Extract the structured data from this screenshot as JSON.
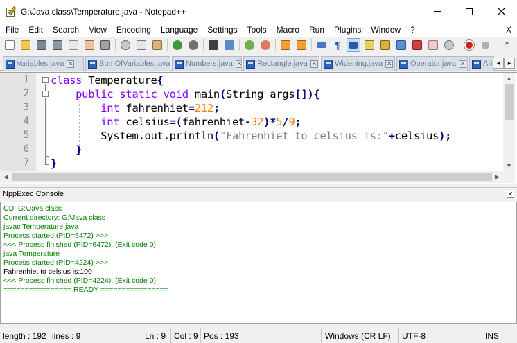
{
  "window": {
    "title": "G:\\Java class\\Temperature.java - Notepad++"
  },
  "menu": {
    "items": [
      "File",
      "Edit",
      "Search",
      "View",
      "Encoding",
      "Language",
      "Settings",
      "Tools",
      "Macro",
      "Run",
      "Plugins",
      "Window",
      "?"
    ],
    "close_label": "X"
  },
  "toolbar": {
    "buttons": [
      "new-file",
      "open-file",
      "save",
      "save-all",
      "close",
      "close-all",
      "print",
      "cut",
      "copy",
      "paste",
      "undo",
      "redo",
      "find",
      "replace",
      "zoom-in",
      "zoom-out",
      "sync-vertical",
      "sync-horizontal",
      "word-wrap",
      "show-all-chars",
      "indent-guide",
      "udl",
      "doc-map",
      "function-list",
      "folder-as-workspace",
      "monitoring",
      "record-macro",
      "stop-record"
    ]
  },
  "tabs": [
    {
      "label": "Variables.java"
    },
    {
      "label": "SumOfVariables.java"
    },
    {
      "label": "Numbers.java"
    },
    {
      "label": "Rectangle.java"
    },
    {
      "label": "Widening.java"
    },
    {
      "label": "Operator.java"
    },
    {
      "label": "Arit"
    }
  ],
  "editor": {
    "line_numbers": [
      "1",
      "2",
      "3",
      "4",
      "5",
      "6",
      "7"
    ],
    "lines": [
      [
        {
          "t": "class",
          "c": "kw"
        },
        {
          "t": " Temperature",
          "c": "plain"
        },
        {
          "t": "{",
          "c": "op"
        }
      ],
      [
        {
          "t": "    ",
          "c": "plain"
        },
        {
          "t": "public",
          "c": "kw"
        },
        {
          "t": " ",
          "c": "plain"
        },
        {
          "t": "static",
          "c": "kw"
        },
        {
          "t": " ",
          "c": "plain"
        },
        {
          "t": "void",
          "c": "kwt"
        },
        {
          "t": " main",
          "c": "plain"
        },
        {
          "t": "(",
          "c": "op"
        },
        {
          "t": "String args",
          "c": "plain"
        },
        {
          "t": "[]){",
          "c": "op"
        }
      ],
      [
        {
          "t": "        ",
          "c": "plain"
        },
        {
          "t": "int",
          "c": "kwt"
        },
        {
          "t": " fahrenhiet",
          "c": "plain"
        },
        {
          "t": "=",
          "c": "op"
        },
        {
          "t": "212",
          "c": "num"
        },
        {
          "t": ";",
          "c": "op"
        }
      ],
      [
        {
          "t": "        ",
          "c": "plain"
        },
        {
          "t": "int",
          "c": "kwt"
        },
        {
          "t": " celsius",
          "c": "plain"
        },
        {
          "t": "=(",
          "c": "op"
        },
        {
          "t": "fahrenhiet",
          "c": "plain"
        },
        {
          "t": "-",
          "c": "op"
        },
        {
          "t": "32",
          "c": "num"
        },
        {
          "t": ")*",
          "c": "op"
        },
        {
          "t": "5",
          "c": "num"
        },
        {
          "t": "/",
          "c": "op"
        },
        {
          "t": "9",
          "c": "num"
        },
        {
          "t": ";",
          "c": "op"
        }
      ],
      [
        {
          "t": "        System",
          "c": "plain"
        },
        {
          "t": ".",
          "c": "op"
        },
        {
          "t": "out",
          "c": "plain"
        },
        {
          "t": ".",
          "c": "op"
        },
        {
          "t": "println",
          "c": "plain"
        },
        {
          "t": "(",
          "c": "op"
        },
        {
          "t": "\"Fahrenhiet to celsius is:\"",
          "c": "str"
        },
        {
          "t": "+",
          "c": "op"
        },
        {
          "t": "celsius",
          "c": "plain"
        },
        {
          "t": ");",
          "c": "op"
        }
      ],
      [
        {
          "t": "    ",
          "c": "plain"
        },
        {
          "t": "}",
          "c": "op"
        }
      ],
      [
        {
          "t": "}",
          "c": "op"
        }
      ]
    ]
  },
  "console": {
    "title": "NppExec Console",
    "lines": [
      {
        "text": "CD: G:\\Java class",
        "color": "green"
      },
      {
        "text": "Current directory: G:\\Java class",
        "color": "green"
      },
      {
        "text": "javac Temperature.java",
        "color": "green"
      },
      {
        "text": "Process started (PID=6472) >>>",
        "color": "green"
      },
      {
        "text": "<<< Process finished (PID=6472). (Exit code 0)",
        "color": "green"
      },
      {
        "text": "java Temperature",
        "color": "green"
      },
      {
        "text": "Process started (PID=4224) >>>",
        "color": "green"
      },
      {
        "text": "Fahrenhiet to celsius is:100",
        "color": "black"
      },
      {
        "text": "<<< Process finished (PID=4224). (Exit code 0)",
        "color": "green"
      },
      {
        "text": "================ READY ================",
        "color": "green"
      }
    ]
  },
  "status": {
    "length": "length : 192",
    "lines": "lines : 9",
    "ln": "Ln : 9",
    "col": "Col : 9",
    "pos": "Pos : 193",
    "eol": "Windows (CR LF)",
    "encoding": "UTF-8",
    "mode": "INS"
  },
  "colors": {
    "keyword": "#8000ff",
    "number": "#ff8000",
    "string": "#808080",
    "operator": "#000080",
    "console_green": "#008000"
  }
}
